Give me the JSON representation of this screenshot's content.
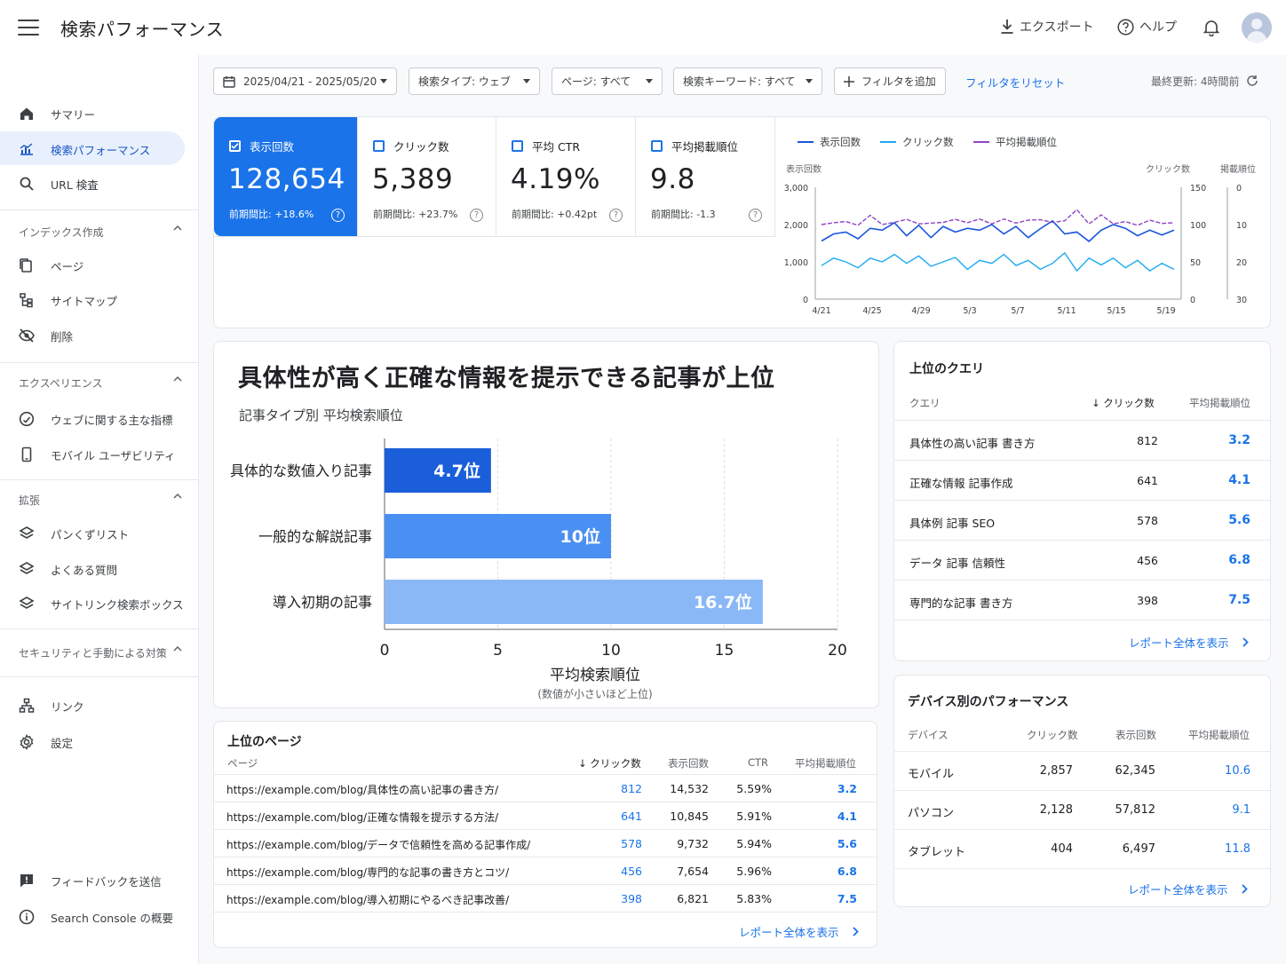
{
  "header": {
    "title": "検索パフォーマンス",
    "export_label": "エクスポート",
    "help_label": "ヘルプ"
  },
  "sidebar": {
    "top_items": [
      {
        "label": "サマリー",
        "icon": "home-icon"
      },
      {
        "label": "検索パフォーマンス",
        "icon": "bar-chart-icon",
        "active": true
      },
      {
        "label": "URL 検査",
        "icon": "search-icon"
      }
    ],
    "sections": [
      {
        "title": "インデックス作成",
        "items": [
          {
            "label": "ページ",
            "icon": "pages-icon"
          },
          {
            "label": "サイトマップ",
            "icon": "sitemap-icon"
          },
          {
            "label": "削除",
            "icon": "eye-off-icon"
          }
        ]
      },
      {
        "title": "エクスペリエンス",
        "items": [
          {
            "label": "ウェブに関する主な指標",
            "icon": "gauge-icon"
          },
          {
            "label": "モバイル ユーザビリティ",
            "icon": "phone-icon"
          }
        ]
      },
      {
        "title": "拡張",
        "items": [
          {
            "label": "パンくずリスト",
            "icon": "layers-icon"
          },
          {
            "label": "よくある質問",
            "icon": "layers-icon"
          },
          {
            "label": "サイトリンク検索ボックス",
            "icon": "layers-icon"
          }
        ]
      },
      {
        "title": "セキュリティと手動による対策",
        "items": []
      }
    ],
    "bottom_items": [
      {
        "label": "リンク",
        "icon": "links-icon"
      },
      {
        "label": "設定",
        "icon": "gear-icon"
      }
    ],
    "footer_items": [
      {
        "label": "フィードバックを送信",
        "icon": "feedback-icon"
      },
      {
        "label": "Search Console の概要",
        "icon": "info-icon"
      }
    ]
  },
  "filters": {
    "date": "2025/04/21 - 2025/05/20",
    "search_type": "検索タイプ: ウェブ",
    "page": "ページ: すべて",
    "query": "検索キーワード: すべて",
    "add_filter": "フィルタを追加",
    "reset": "フィルタをリセット",
    "updated": "最終更新: 4時間前"
  },
  "metrics": [
    {
      "label": "表示回数",
      "value": "128,654",
      "change": "前期間比: +18.6%",
      "selected": true
    },
    {
      "label": "クリック数",
      "value": "5,389",
      "change": "前期間比: +23.7%"
    },
    {
      "label": "平均 CTR",
      "value": "4.19%",
      "change": "前期間比: +0.42pt"
    },
    {
      "label": "平均掲載順位",
      "value": "9.8",
      "change": "前期間比: -1.3"
    }
  ],
  "trend": {
    "legend": [
      "表示回数",
      "クリック数",
      "平均掲載順位"
    ],
    "colors": [
      "#1a56db",
      "#1eaaf1",
      "#8e44c4"
    ],
    "axis_left_title": "表示回数",
    "axis_right1_title": "クリック数",
    "axis_right2_title": "掲載順位",
    "y_left_ticks": [
      "3,000",
      "2,000",
      "1,000",
      "0"
    ],
    "y_right1_ticks": [
      "150",
      "100",
      "50",
      "0"
    ],
    "y_right2_ticks": [
      "0",
      "10",
      "20",
      "30"
    ],
    "x_ticks": [
      "4/21",
      "4/25",
      "4/29",
      "5/3",
      "5/7",
      "5/11",
      "5/15",
      "5/19"
    ]
  },
  "chart_data": {
    "type": "bar",
    "title": "具体性が高く正確な情報を提示できる記事が上位",
    "subtitle": "記事タイプ別 平均検索順位",
    "categories": [
      "具体的な数値入り記事",
      "一般的な解説記事",
      "導入初期の記事"
    ],
    "values": [
      4.7,
      10,
      16.7
    ],
    "data_labels": [
      "4.7位",
      "10位",
      "16.7位"
    ],
    "xlabel": "平均検索順位",
    "xlabel_note": "(数値が小さいほど上位)",
    "xlim": [
      0,
      20
    ],
    "x_ticks": [
      "0",
      "5",
      "10",
      "15",
      "20"
    ],
    "colors": [
      "#1a5fd9",
      "#4a90f2",
      "#8ab8f7"
    ],
    "grid": true
  },
  "top_pages": {
    "title": "上位のページ",
    "headers": [
      "ページ",
      "クリック数",
      "表示回数",
      "CTR",
      "平均掲載順位"
    ],
    "rows": [
      [
        "https://example.com/blog/具体性の高い記事の書き方/",
        "812",
        "14,532",
        "5.59%",
        "3.2"
      ],
      [
        "https://example.com/blog/正確な情報を提示する方法/",
        "641",
        "10,845",
        "5.91%",
        "4.1"
      ],
      [
        "https://example.com/blog/データで信頼性を高める記事作成/",
        "578",
        "9,732",
        "5.94%",
        "5.6"
      ],
      [
        "https://example.com/blog/専門的な記事の書き方とコツ/",
        "456",
        "7,654",
        "5.96%",
        "6.8"
      ],
      [
        "https://example.com/blog/導入初期にやるべき記事改善/",
        "398",
        "6,821",
        "5.83%",
        "7.5"
      ]
    ],
    "more": "レポート全体を表示"
  },
  "top_queries": {
    "title": "上位のクエリ",
    "headers": [
      "クエリ",
      "クリック数",
      "平均掲載順位"
    ],
    "rows": [
      [
        "具体性の高い記事 書き方",
        "812",
        "3.2"
      ],
      [
        "正確な情報 記事作成",
        "641",
        "4.1"
      ],
      [
        "具体例 記事 SEO",
        "578",
        "5.6"
      ],
      [
        "データ 記事 信頼性",
        "456",
        "6.8"
      ],
      [
        "専門的な記事 書き方",
        "398",
        "7.5"
      ]
    ],
    "more": "レポート全体を表示"
  },
  "devices": {
    "title": "デバイス別のパフォーマンス",
    "headers": [
      "デバイス",
      "クリック数",
      "表示回数",
      "平均掲載順位"
    ],
    "rows": [
      [
        "モバイル",
        "2,857",
        "62,345",
        "10.6"
      ],
      [
        "パソコン",
        "2,128",
        "57,812",
        "9.1"
      ],
      [
        "タブレット",
        "404",
        "6,497",
        "11.8"
      ]
    ],
    "more": "レポート全体を表示"
  }
}
